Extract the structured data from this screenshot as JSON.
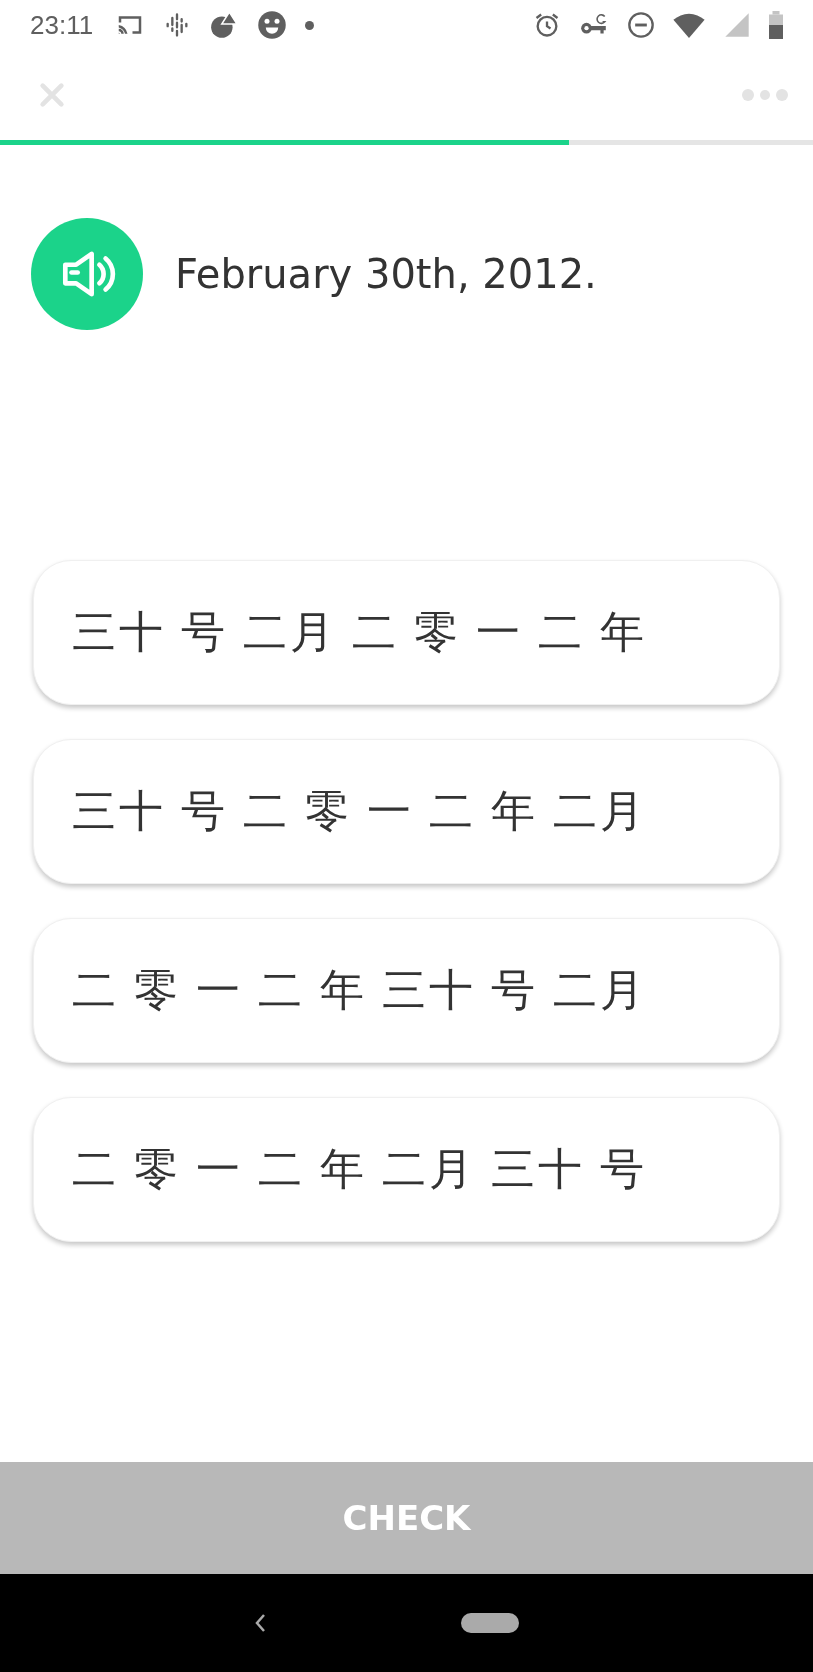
{
  "status_bar": {
    "time": "23:11"
  },
  "progress": {
    "level": 0.7
  },
  "prompt": {
    "text": "February 30th, 2012."
  },
  "options": [
    {
      "text": "三十 号 二月 二 零 一 二 年",
      "selected": false
    },
    {
      "text": "三十 号 二 零 一 二 年 二月",
      "selected": false
    },
    {
      "text": "二 零 一 二 年 三十 号 二月",
      "selected": false
    },
    {
      "text": "二 零 一 二 年 二月 三十 号",
      "selected": false
    }
  ],
  "check_button": {
    "label": "CHECK",
    "disabled": true
  }
}
